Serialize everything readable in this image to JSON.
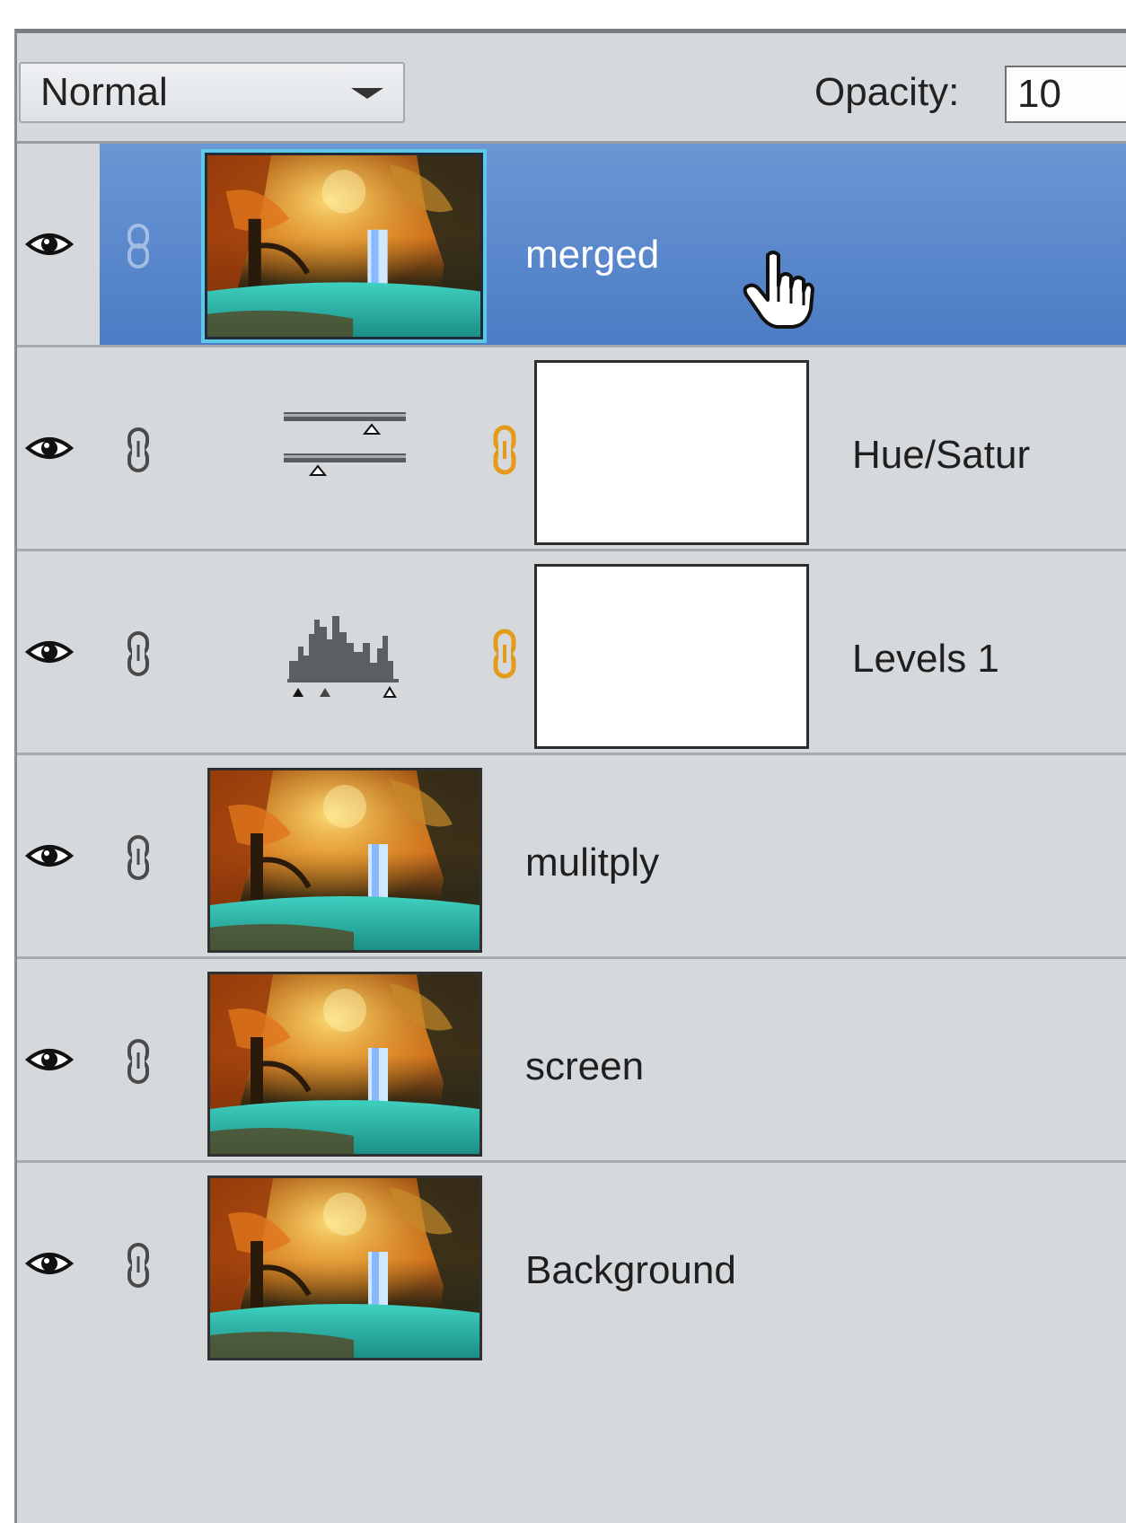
{
  "toolbar": {
    "blend_mode": "Normal",
    "opacity_label": "Opacity:",
    "opacity_value": "10"
  },
  "layers": [
    {
      "name": "merged",
      "type": "pixel",
      "selected": true,
      "visible": true
    },
    {
      "name": "Hue/Satur",
      "type": "adjustment-hue-saturation",
      "selected": false,
      "visible": true
    },
    {
      "name": "Levels 1",
      "type": "adjustment-levels",
      "selected": false,
      "visible": true
    },
    {
      "name": "mulitply",
      "type": "pixel",
      "selected": false,
      "visible": true
    },
    {
      "name": "screen",
      "type": "pixel",
      "selected": false,
      "visible": true
    },
    {
      "name": "Background",
      "type": "pixel",
      "selected": false,
      "visible": true
    }
  ],
  "icons": {
    "visibility": "eye-icon",
    "link": "link-icon",
    "mask_link": "mask-link-icon",
    "pointer": "hand-cursor-icon"
  },
  "colors": {
    "panel_bg": "#d6d9dc",
    "selection": "#5a88cc",
    "selection_outline": "#5fc8e6",
    "mask_link": "#e59a1c"
  }
}
